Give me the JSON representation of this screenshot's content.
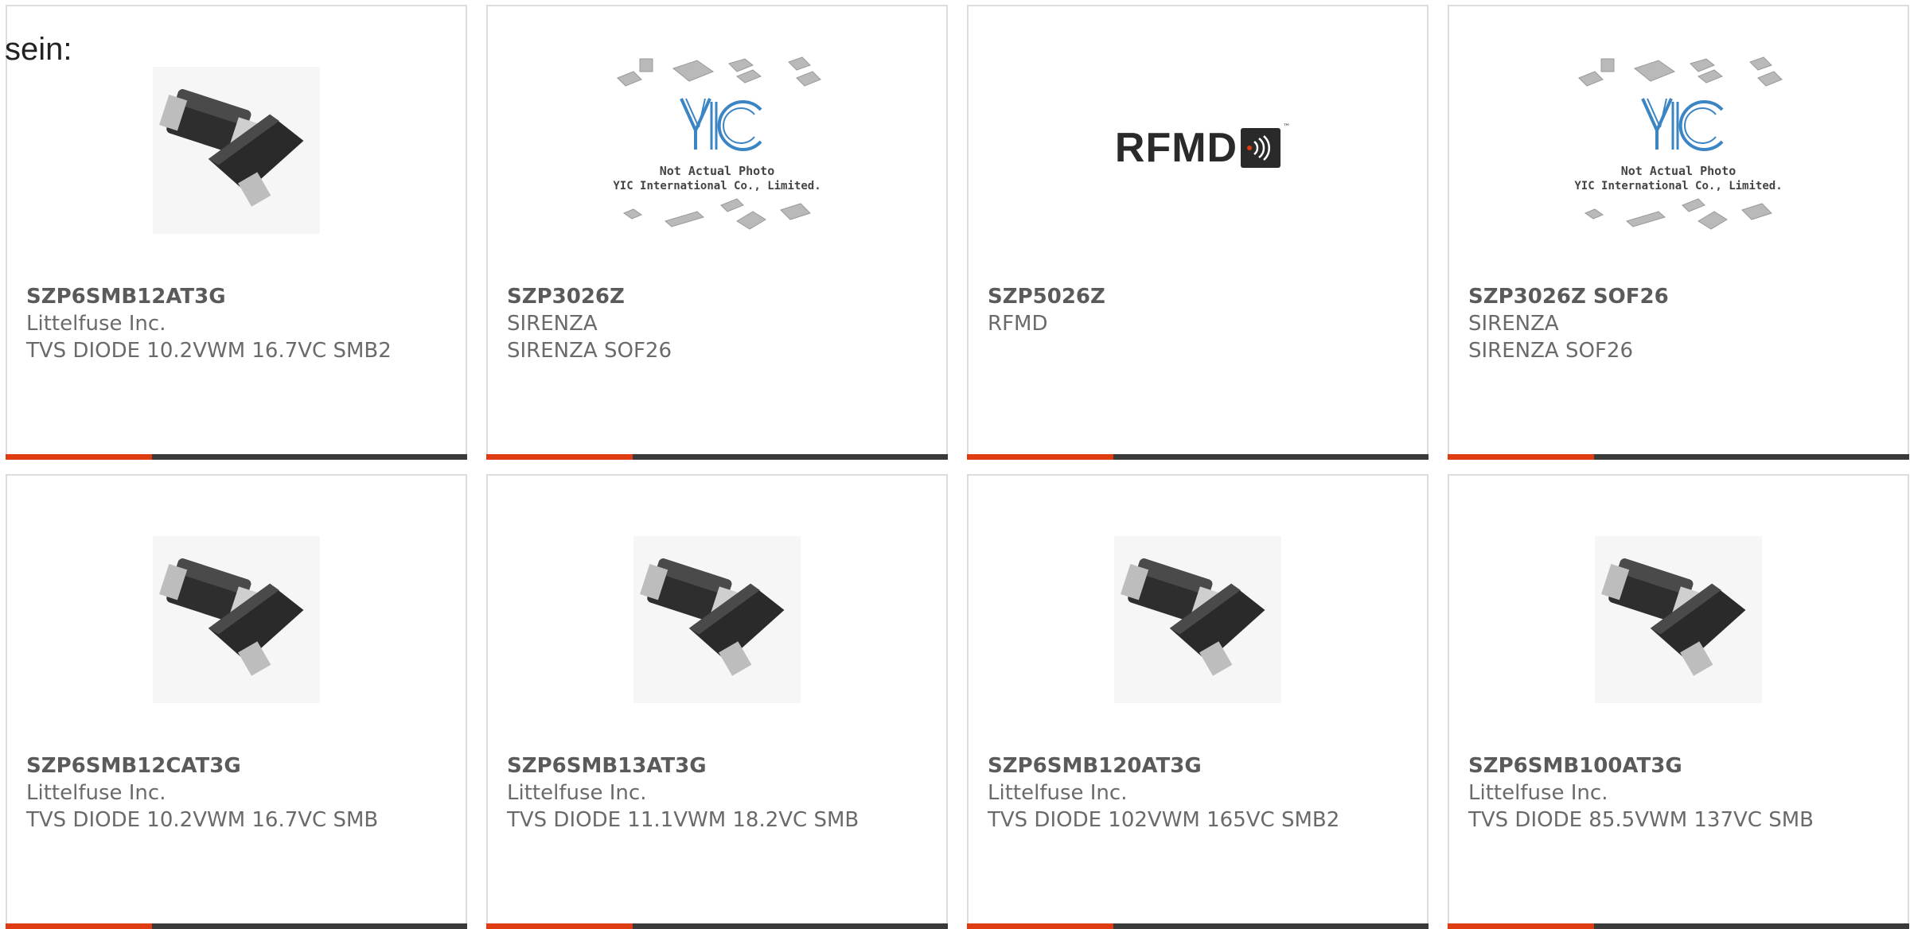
{
  "page": {
    "lead_text": "sein:"
  },
  "colors": {
    "accent": "#e03c11",
    "bar": "#3a3a3a",
    "border": "#dddddd",
    "text": "#5a5a5a"
  },
  "yic_label": {
    "line1": "Not Actual Photo",
    "line2": "YIC International Co., Limited.",
    "logo": "YIC"
  },
  "rfmd_label": {
    "word": "RFMD",
    "tm": "™"
  },
  "products": [
    {
      "part": "SZP6SMB12AT3G",
      "manufacturer": "Littelfuse Inc.",
      "description": "TVS DIODE 10.2VWM 16.7VC SMB2",
      "image": "diode"
    },
    {
      "part": "SZP3026Z",
      "manufacturer": "SIRENZA",
      "description": "SIRENZA SOF26",
      "image": "yic"
    },
    {
      "part": "SZP5026Z",
      "manufacturer": "RFMD",
      "description": "",
      "image": "rfmd"
    },
    {
      "part": "SZP3026Z SOF26",
      "manufacturer": "SIRENZA",
      "description": "SIRENZA SOF26",
      "image": "yic"
    },
    {
      "part": "SZP6SMB12CAT3G",
      "manufacturer": "Littelfuse Inc.",
      "description": "TVS DIODE 10.2VWM 16.7VC SMB",
      "image": "diode"
    },
    {
      "part": "SZP6SMB13AT3G",
      "manufacturer": "Littelfuse Inc.",
      "description": "TVS DIODE 11.1VWM 18.2VC SMB",
      "image": "diode"
    },
    {
      "part": "SZP6SMB120AT3G",
      "manufacturer": "Littelfuse Inc.",
      "description": "TVS DIODE 102VWM 165VC SMB2",
      "image": "diode"
    },
    {
      "part": "SZP6SMB100AT3G",
      "manufacturer": "Littelfuse Inc.",
      "description": "TVS DIODE 85.5VWM 137VC SMB",
      "image": "diode"
    }
  ]
}
